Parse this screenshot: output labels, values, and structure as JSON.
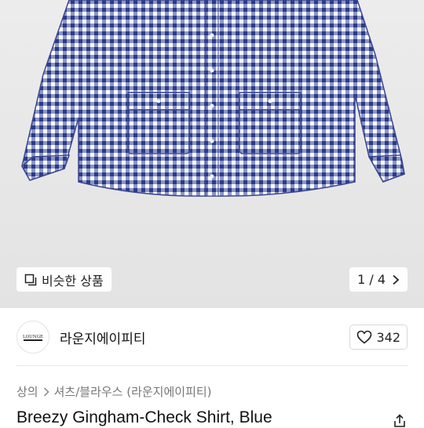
{
  "hero": {
    "similar_button_label": "비슷한 상품",
    "pager_text": "1 / 4"
  },
  "seller": {
    "logo_text": "LOUNGE",
    "name": "라운지에이피티",
    "like_count": "342"
  },
  "breadcrumb": {
    "items": [
      "상의",
      "셔츠/블라우스 (라운지에이피티)"
    ]
  },
  "product": {
    "title": "Breezy Gingham-Check Shirt, Blue"
  },
  "icons": {
    "similar": "similar-products-icon",
    "next": "chevron-right-icon",
    "like": "heart-icon",
    "share": "share-icon"
  },
  "colors": {
    "gingham_dark": "#2c3a86",
    "gingham_light": "#8b96c7"
  }
}
